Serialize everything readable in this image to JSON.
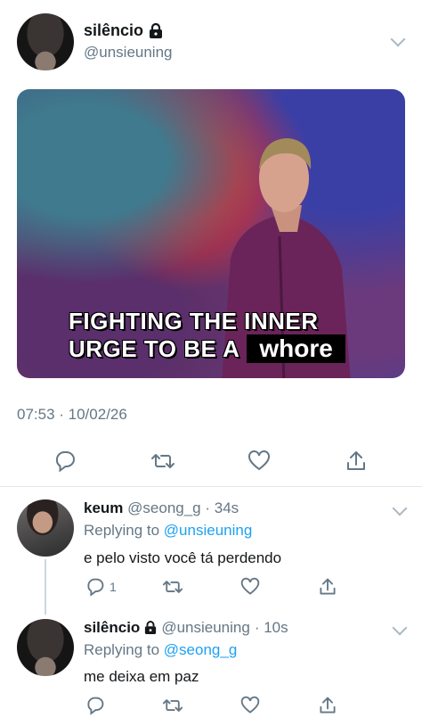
{
  "main_tweet": {
    "author_name": "silêncio",
    "author_handle": "@unsieuning",
    "caption_line1": "FIGHTING THE INNER",
    "caption_line2_prefix": "URGE TO BE A",
    "caption_highlight": "whore",
    "timestamp": "07:53 · 10/02/26"
  },
  "replies": [
    {
      "author_name": "keum",
      "author_handle": "@seong_g",
      "age": "· 34s",
      "replying_prefix": "Replying to",
      "replying_to": "@unsieuning",
      "text": "e pelo visto você tá perdendo",
      "reply_count": "1"
    },
    {
      "author_name": "silêncio",
      "author_handle": "@unsieuning",
      "age": "· 10s",
      "replying_prefix": "Replying to",
      "replying_to": "@seong_g",
      "text": "me deixa em paz",
      "reply_count": ""
    }
  ],
  "colors": {
    "accent": "#1da1f2",
    "secondary_text": "#657786",
    "icon": "#657786"
  },
  "icons": [
    "lock-icon",
    "chevron-down-icon",
    "reply-icon",
    "retweet-icon",
    "like-icon",
    "share-icon"
  ]
}
